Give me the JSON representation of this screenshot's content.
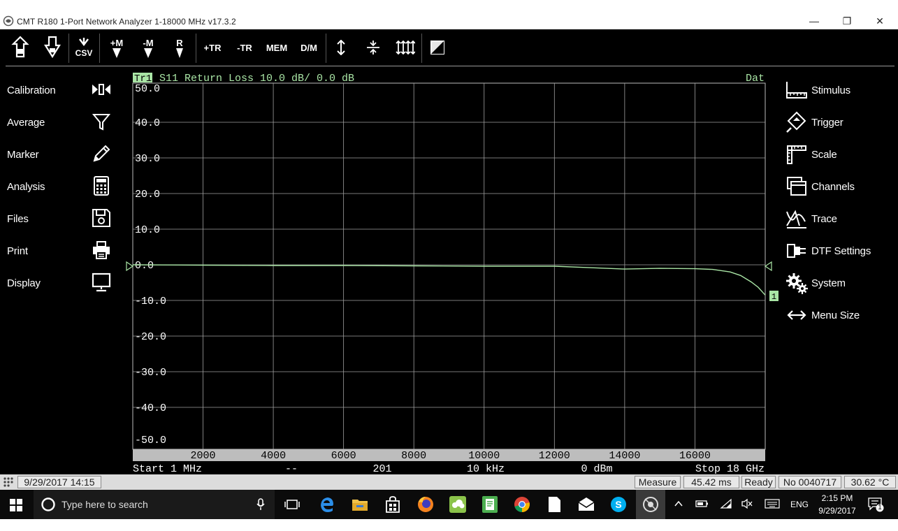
{
  "window": {
    "title": "CMT  R180 1-Port Network Analyzer  1-18000 MHz  v17.3.2",
    "minimize": "—",
    "maximize": "❐",
    "close": "✕"
  },
  "toolbar": {
    "csv_label": "CSV",
    "add_marker": "+M",
    "remove_marker": "-M",
    "reference": "R",
    "add_trace": "+TR",
    "remove_trace": "-TR",
    "memory": "MEM",
    "data_memory": "D/M"
  },
  "left_menu": [
    {
      "label": "Calibration",
      "icon": "calibration-icon"
    },
    {
      "label": "Average",
      "icon": "filter-icon"
    },
    {
      "label": "Marker",
      "icon": "pencil-icon"
    },
    {
      "label": "Analysis",
      "icon": "calculator-icon"
    },
    {
      "label": "Files",
      "icon": "floppy-disk-icon"
    },
    {
      "label": "Print",
      "icon": "printer-icon"
    },
    {
      "label": "Display",
      "icon": "monitor-icon"
    }
  ],
  "right_menu": [
    {
      "label": "Stimulus",
      "icon": "ruler-icon"
    },
    {
      "label": "Trigger",
      "icon": "trigger-icon"
    },
    {
      "label": "Scale",
      "icon": "scale-icon"
    },
    {
      "label": "Channels",
      "icon": "channels-icon"
    },
    {
      "label": "Trace",
      "icon": "trace-icon"
    },
    {
      "label": "DTF Settings",
      "icon": "dtf-icon"
    },
    {
      "label": "System",
      "icon": "gears-icon"
    },
    {
      "label": "Menu Size",
      "icon": "resize-arrows-icon"
    }
  ],
  "chart_data": {
    "type": "line",
    "trace_tag": "Tr1",
    "title": "S11 Return Loss 10.0 dB/ 0.0 dB",
    "format_tag": "Dat",
    "trace_marker": "1",
    "xlim": [
      1,
      18000
    ],
    "ylim": [
      -50,
      50
    ],
    "x_ticks": [
      2000,
      4000,
      6000,
      8000,
      10000,
      12000,
      14000,
      16000
    ],
    "y_ticks": [
      "50.0",
      "40.0",
      "30.0",
      "20.0",
      "10.0",
      "0.0",
      "-10.0",
      "-20.0",
      "-30.0",
      "-40.0",
      "-50.0"
    ],
    "grid": true,
    "line_color": "#a9e5a5",
    "series": [
      {
        "x": [
          1,
          2000,
          4000,
          6000,
          8000,
          10000,
          11000,
          12000,
          13000,
          14000,
          15000,
          16000,
          16500,
          17000,
          17300,
          17600,
          17800,
          18000
        ],
        "y": [
          0.0,
          -0.1,
          -0.2,
          -0.2,
          -0.3,
          -0.4,
          -0.4,
          -0.4,
          -0.8,
          -1.2,
          -1.0,
          -1.1,
          -1.3,
          -2.0,
          -3.0,
          -4.8,
          -6.3,
          -8.5
        ]
      }
    ]
  },
  "chart_footer": {
    "start": "Start 1 MHz",
    "dashes": "--",
    "points": "201",
    "ifbw": "10 kHz",
    "power": "0 dBm",
    "stop": "Stop 18 GHz"
  },
  "status": {
    "datetime": "9/29/2017 14:15",
    "mode": "Measure",
    "sweep_time": "45.42 ms",
    "state": "Ready",
    "serial": "No 0040717",
    "temperature": "30.62 °C"
  },
  "taskbar": {
    "search_placeholder": "Type here to search",
    "language": "ENG",
    "time": "2:15 PM",
    "date": "9/29/2017",
    "notification_count": "1"
  },
  "colors": {
    "grid": "#a0a0a0",
    "axis_band": "#bdbdbd",
    "trace": "#a9e5a5",
    "background": "#000000"
  }
}
